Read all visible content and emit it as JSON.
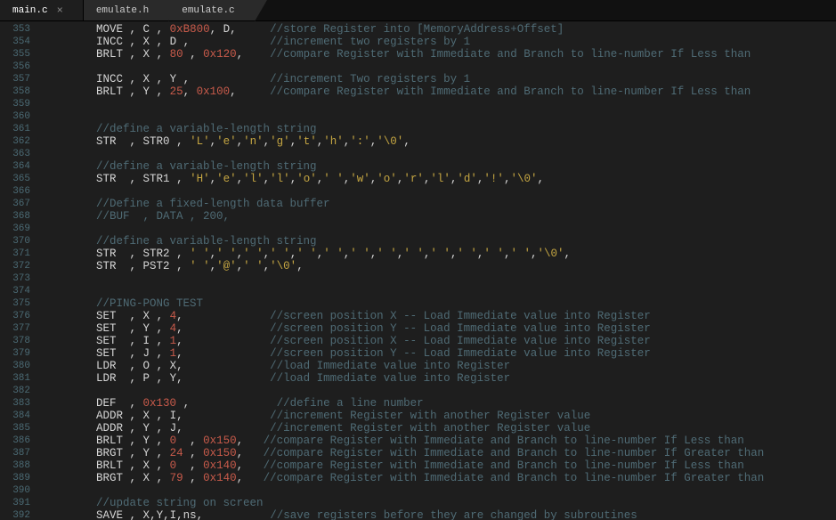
{
  "tabs": [
    {
      "label": "main.c",
      "active": true
    },
    {
      "label": "emulate.h",
      "active": false
    },
    {
      "label": "emulate.c",
      "active": false
    }
  ],
  "first_line": 353,
  "lines": [
    [
      [
        "op",
        "MOVE "
      ],
      [
        "punc",
        ", "
      ],
      [
        "reg",
        "C "
      ],
      [
        "punc",
        ", "
      ],
      [
        "num",
        "0xB800"
      ],
      [
        "punc",
        ", "
      ],
      [
        "reg",
        "D"
      ],
      [
        "punc",
        ","
      ],
      [
        "ws",
        "     "
      ],
      [
        "cmt",
        "//store Register into [MemoryAddress+Offset]"
      ]
    ],
    [
      [
        "op",
        "INCC "
      ],
      [
        "punc",
        ", "
      ],
      [
        "reg",
        "X "
      ],
      [
        "punc",
        ", "
      ],
      [
        "reg",
        "D "
      ],
      [
        "punc",
        ","
      ],
      [
        "ws",
        "            "
      ],
      [
        "cmt",
        "//increment two registers by 1"
      ]
    ],
    [
      [
        "op",
        "BRLT "
      ],
      [
        "punc",
        ", "
      ],
      [
        "reg",
        "X "
      ],
      [
        "punc",
        ", "
      ],
      [
        "num",
        "80 "
      ],
      [
        "punc",
        ", "
      ],
      [
        "num",
        "0x120"
      ],
      [
        "punc",
        ","
      ],
      [
        "ws",
        "    "
      ],
      [
        "cmt",
        "//compare Register with Immediate and Branch to line-number If Less than"
      ]
    ],
    [],
    [
      [
        "op",
        "INCC "
      ],
      [
        "punc",
        ", "
      ],
      [
        "reg",
        "X "
      ],
      [
        "punc",
        ", "
      ],
      [
        "reg",
        "Y "
      ],
      [
        "punc",
        ","
      ],
      [
        "ws",
        "            "
      ],
      [
        "cmt",
        "//increment Two registers by 1"
      ]
    ],
    [
      [
        "op",
        "BRLT "
      ],
      [
        "punc",
        ", "
      ],
      [
        "reg",
        "Y "
      ],
      [
        "punc",
        ", "
      ],
      [
        "num",
        "25"
      ],
      [
        "punc",
        ", "
      ],
      [
        "num",
        "0x100"
      ],
      [
        "punc",
        ","
      ],
      [
        "ws",
        "     "
      ],
      [
        "cmt",
        "//compare Register with Immediate and Branch to line-number If Less than"
      ]
    ],
    [],
    [],
    [
      [
        "cmt",
        "//define a variable-length string"
      ]
    ],
    [
      [
        "op",
        "STR  "
      ],
      [
        "punc",
        ", "
      ],
      [
        "reg",
        "STR0 "
      ],
      [
        "punc",
        ", "
      ],
      [
        "str",
        "'L'"
      ],
      [
        "punc",
        ","
      ],
      [
        "str",
        "'e'"
      ],
      [
        "punc",
        ","
      ],
      [
        "str",
        "'n'"
      ],
      [
        "punc",
        ","
      ],
      [
        "str",
        "'g'"
      ],
      [
        "punc",
        ","
      ],
      [
        "str",
        "'t'"
      ],
      [
        "punc",
        ","
      ],
      [
        "str",
        "'h'"
      ],
      [
        "punc",
        ","
      ],
      [
        "str",
        "':'"
      ],
      [
        "punc",
        ","
      ],
      [
        "str",
        "'\\0'"
      ],
      [
        "punc",
        ","
      ]
    ],
    [],
    [
      [
        "cmt",
        "//define a variable-length string"
      ]
    ],
    [
      [
        "op",
        "STR  "
      ],
      [
        "punc",
        ", "
      ],
      [
        "reg",
        "STR1 "
      ],
      [
        "punc",
        ", "
      ],
      [
        "str",
        "'H'"
      ],
      [
        "punc",
        ","
      ],
      [
        "str",
        "'e'"
      ],
      [
        "punc",
        ","
      ],
      [
        "str",
        "'l'"
      ],
      [
        "punc",
        ","
      ],
      [
        "str",
        "'l'"
      ],
      [
        "punc",
        ","
      ],
      [
        "str",
        "'o'"
      ],
      [
        "punc",
        ","
      ],
      [
        "str",
        "' '"
      ],
      [
        "punc",
        ","
      ],
      [
        "str",
        "'w'"
      ],
      [
        "punc",
        ","
      ],
      [
        "str",
        "'o'"
      ],
      [
        "punc",
        ","
      ],
      [
        "str",
        "'r'"
      ],
      [
        "punc",
        ","
      ],
      [
        "str",
        "'l'"
      ],
      [
        "punc",
        ","
      ],
      [
        "str",
        "'d'"
      ],
      [
        "punc",
        ","
      ],
      [
        "str",
        "'!'"
      ],
      [
        "punc",
        ","
      ],
      [
        "str",
        "'\\0'"
      ],
      [
        "punc",
        ","
      ]
    ],
    [],
    [
      [
        "cmt",
        "//Define a fixed-length data buffer"
      ]
    ],
    [
      [
        "cmt",
        "//BUF  , DATA , 200,"
      ]
    ],
    [],
    [
      [
        "cmt",
        "//define a variable-length string"
      ]
    ],
    [
      [
        "op",
        "STR  "
      ],
      [
        "punc",
        ", "
      ],
      [
        "reg",
        "STR2 "
      ],
      [
        "punc",
        ", "
      ],
      [
        "str",
        "' '"
      ],
      [
        "punc",
        ","
      ],
      [
        "str",
        "' '"
      ],
      [
        "punc",
        ","
      ],
      [
        "str",
        "' '"
      ],
      [
        "punc",
        ","
      ],
      [
        "str",
        "' '"
      ],
      [
        "punc",
        ","
      ],
      [
        "str",
        "' '"
      ],
      [
        "punc",
        ","
      ],
      [
        "str",
        "' '"
      ],
      [
        "punc",
        ","
      ],
      [
        "str",
        "' '"
      ],
      [
        "punc",
        ","
      ],
      [
        "str",
        "' '"
      ],
      [
        "punc",
        ","
      ],
      [
        "str",
        "' '"
      ],
      [
        "punc",
        ","
      ],
      [
        "str",
        "' '"
      ],
      [
        "punc",
        ","
      ],
      [
        "str",
        "' '"
      ],
      [
        "punc",
        ","
      ],
      [
        "str",
        "' '"
      ],
      [
        "punc",
        ","
      ],
      [
        "str",
        "' '"
      ],
      [
        "punc",
        ","
      ],
      [
        "str",
        "'\\0'"
      ],
      [
        "punc",
        ","
      ]
    ],
    [
      [
        "op",
        "STR  "
      ],
      [
        "punc",
        ", "
      ],
      [
        "reg",
        "PST2 "
      ],
      [
        "punc",
        ", "
      ],
      [
        "str",
        "' '"
      ],
      [
        "punc",
        ","
      ],
      [
        "str",
        "'@'"
      ],
      [
        "punc",
        ","
      ],
      [
        "str",
        "' '"
      ],
      [
        "punc",
        ","
      ],
      [
        "str",
        "'\\0'"
      ],
      [
        "punc",
        ","
      ]
    ],
    [],
    [],
    [
      [
        "cmt",
        "//PING-PONG TEST"
      ]
    ],
    [
      [
        "op",
        "SET  "
      ],
      [
        "punc",
        ", "
      ],
      [
        "reg",
        "X "
      ],
      [
        "punc",
        ", "
      ],
      [
        "num",
        "4"
      ],
      [
        "punc",
        ","
      ],
      [
        "ws",
        "             "
      ],
      [
        "cmt",
        "//screen position X -- Load Immediate value into Register"
      ]
    ],
    [
      [
        "op",
        "SET  "
      ],
      [
        "punc",
        ", "
      ],
      [
        "reg",
        "Y "
      ],
      [
        "punc",
        ", "
      ],
      [
        "num",
        "4"
      ],
      [
        "punc",
        ","
      ],
      [
        "ws",
        "             "
      ],
      [
        "cmt",
        "//screen position Y -- Load Immediate value into Register"
      ]
    ],
    [
      [
        "op",
        "SET  "
      ],
      [
        "punc",
        ", "
      ],
      [
        "reg",
        "I "
      ],
      [
        "punc",
        ", "
      ],
      [
        "num",
        "1"
      ],
      [
        "punc",
        ","
      ],
      [
        "ws",
        "             "
      ],
      [
        "cmt",
        "//screen position X -- Load Immediate value into Register"
      ]
    ],
    [
      [
        "op",
        "SET  "
      ],
      [
        "punc",
        ", "
      ],
      [
        "reg",
        "J "
      ],
      [
        "punc",
        ", "
      ],
      [
        "num",
        "1"
      ],
      [
        "punc",
        ","
      ],
      [
        "ws",
        "             "
      ],
      [
        "cmt",
        "//screen position Y -- Load Immediate value into Register"
      ]
    ],
    [
      [
        "op",
        "LDR  "
      ],
      [
        "punc",
        ", "
      ],
      [
        "reg",
        "O "
      ],
      [
        "punc",
        ", "
      ],
      [
        "reg",
        "X"
      ],
      [
        "punc",
        ","
      ],
      [
        "ws",
        "             "
      ],
      [
        "cmt",
        "//load Immediate value into Register"
      ]
    ],
    [
      [
        "op",
        "LDR  "
      ],
      [
        "punc",
        ", "
      ],
      [
        "reg",
        "P "
      ],
      [
        "punc",
        ", "
      ],
      [
        "reg",
        "Y"
      ],
      [
        "punc",
        ","
      ],
      [
        "ws",
        "             "
      ],
      [
        "cmt",
        "//load Immediate value into Register"
      ]
    ],
    [],
    [
      [
        "op",
        "DEF  "
      ],
      [
        "punc",
        ", "
      ],
      [
        "num",
        "0x130 "
      ],
      [
        "punc",
        ","
      ],
      [
        "ws",
        "             "
      ],
      [
        "cmt",
        "//define a line number"
      ]
    ],
    [
      [
        "op",
        "ADDR "
      ],
      [
        "punc",
        ", "
      ],
      [
        "reg",
        "X "
      ],
      [
        "punc",
        ", "
      ],
      [
        "reg",
        "I"
      ],
      [
        "punc",
        ","
      ],
      [
        "ws",
        "             "
      ],
      [
        "cmt",
        "//increment Register with another Register value"
      ]
    ],
    [
      [
        "op",
        "ADDR "
      ],
      [
        "punc",
        ", "
      ],
      [
        "reg",
        "Y "
      ],
      [
        "punc",
        ", "
      ],
      [
        "reg",
        "J"
      ],
      [
        "punc",
        ","
      ],
      [
        "ws",
        "             "
      ],
      [
        "cmt",
        "//increment Register with another Register value"
      ]
    ],
    [
      [
        "op",
        "BRLT "
      ],
      [
        "punc",
        ", "
      ],
      [
        "reg",
        "Y "
      ],
      [
        "punc",
        ", "
      ],
      [
        "num",
        "0  "
      ],
      [
        "punc",
        ", "
      ],
      [
        "num",
        "0x150"
      ],
      [
        "punc",
        ","
      ],
      [
        "ws",
        "   "
      ],
      [
        "cmt",
        "//compare Register with Immediate and Branch to line-number If Less than"
      ]
    ],
    [
      [
        "op",
        "BRGT "
      ],
      [
        "punc",
        ", "
      ],
      [
        "reg",
        "Y "
      ],
      [
        "punc",
        ", "
      ],
      [
        "num",
        "24 "
      ],
      [
        "punc",
        ", "
      ],
      [
        "num",
        "0x150"
      ],
      [
        "punc",
        ","
      ],
      [
        "ws",
        "   "
      ],
      [
        "cmt",
        "//compare Register with Immediate and Branch to line-number If Greater than"
      ]
    ],
    [
      [
        "op",
        "BRLT "
      ],
      [
        "punc",
        ", "
      ],
      [
        "reg",
        "X "
      ],
      [
        "punc",
        ", "
      ],
      [
        "num",
        "0  "
      ],
      [
        "punc",
        ", "
      ],
      [
        "num",
        "0x140"
      ],
      [
        "punc",
        ","
      ],
      [
        "ws",
        "   "
      ],
      [
        "cmt",
        "//compare Register with Immediate and Branch to line-number If Less than"
      ]
    ],
    [
      [
        "op",
        "BRGT "
      ],
      [
        "punc",
        ", "
      ],
      [
        "reg",
        "X "
      ],
      [
        "punc",
        ", "
      ],
      [
        "num",
        "79 "
      ],
      [
        "punc",
        ", "
      ],
      [
        "num",
        "0x140"
      ],
      [
        "punc",
        ","
      ],
      [
        "ws",
        "   "
      ],
      [
        "cmt",
        "//compare Register with Immediate and Branch to line-number If Greater than"
      ]
    ],
    [],
    [
      [
        "cmt",
        "//update string on screen"
      ]
    ],
    [
      [
        "op",
        "SAVE "
      ],
      [
        "punc",
        ", "
      ],
      [
        "reg",
        "X"
      ],
      [
        "punc",
        ","
      ],
      [
        "reg",
        "Y"
      ],
      [
        "punc",
        ","
      ],
      [
        "reg",
        "I"
      ],
      [
        "punc",
        ","
      ],
      [
        "reg",
        "ns"
      ],
      [
        "punc",
        ","
      ],
      [
        "ws",
        "          "
      ],
      [
        "cmt",
        "//save registers before they are changed by subroutines"
      ]
    ]
  ]
}
